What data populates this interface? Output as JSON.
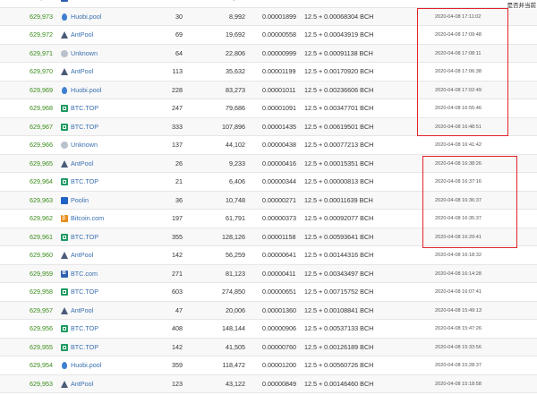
{
  "corner_text": "是否并当前",
  "rows": [
    {
      "height": "629,974",
      "pool": "BTC.com",
      "icon": "btccom",
      "tx": "9",
      "size": "4,090",
      "fee": "0.00001",
      "reward": "12.5 + 0.00...",
      "time": "2020-04-08 17:11:23"
    },
    {
      "height": "629,973",
      "pool": "Huobi.pool",
      "icon": "huobi",
      "tx": "30",
      "size": "8,992",
      "fee": "0.00001899",
      "reward": "12.5 + 0.00068304 BCH",
      "time": "2020-04-08 17:11:02"
    },
    {
      "height": "629,972",
      "pool": "AntPool",
      "icon": "antpool",
      "tx": "69",
      "size": "19,692",
      "fee": "0.00000558",
      "reward": "12.5 + 0.00043919 BCH",
      "time": "2020-04-08 17:09:48"
    },
    {
      "height": "629,971",
      "pool": "Unknown",
      "icon": "unknown",
      "tx": "64",
      "size": "22,806",
      "fee": "0.00000999",
      "reward": "12.5 + 0.00091138 BCH",
      "time": "2020-04-08 17:08:11"
    },
    {
      "height": "629,970",
      "pool": "AntPool",
      "icon": "antpool",
      "tx": "113",
      "size": "35,632",
      "fee": "0.00001199",
      "reward": "12.5 + 0.00170920 BCH",
      "time": "2020-04-08 17:06:38"
    },
    {
      "height": "629,969",
      "pool": "Huobi.pool",
      "icon": "huobi",
      "tx": "228",
      "size": "83,273",
      "fee": "0.00001011",
      "reward": "12.5 + 0.00236606 BCH",
      "time": "2020-04-08 17:02:49"
    },
    {
      "height": "629,968",
      "pool": "BTC.TOP",
      "icon": "btctop",
      "tx": "247",
      "size": "79,686",
      "fee": "0.00001091",
      "reward": "12.5 + 0.00347701 BCH",
      "time": "2020-04-08 16:55:46"
    },
    {
      "height": "629,967",
      "pool": "BTC.TOP",
      "icon": "btctop",
      "tx": "333",
      "size": "107,896",
      "fee": "0.00001435",
      "reward": "12.5 + 0.00619501 BCH",
      "time": "2020-04-08 16:48:51"
    },
    {
      "height": "629,966",
      "pool": "Unknown",
      "icon": "unknown",
      "tx": "137",
      "size": "44,102",
      "fee": "0.00000438",
      "reward": "12.5 + 0.00077213 BCH",
      "time": "2020-04-08 16:41:42"
    },
    {
      "height": "629,965",
      "pool": "AntPool",
      "icon": "antpool",
      "tx": "26",
      "size": "9,233",
      "fee": "0.00000416",
      "reward": "12.5 + 0.00015351 BCH",
      "time": "2020-04-08 16:38:26"
    },
    {
      "height": "629,964",
      "pool": "BTC.TOP",
      "icon": "btctop",
      "tx": "21",
      "size": "6,406",
      "fee": "0.00000344",
      "reward": "12.5 + 0.00000813 BCH",
      "time": "2020-04-08 16:37:16"
    },
    {
      "height": "629,963",
      "pool": "Poolin",
      "icon": "poolin",
      "tx": "36",
      "size": "10,748",
      "fee": "0.00000271",
      "reward": "12.5 + 0.00011639 BCH",
      "time": "2020-04-08 16:36:37"
    },
    {
      "height": "629,962",
      "pool": "Bitcoin.com",
      "icon": "bitcoincom",
      "tx": "197",
      "size": "61,791",
      "fee": "0.00000373",
      "reward": "12.5 + 0.00092077 BCH",
      "time": "2020-04-08 16:35:37"
    },
    {
      "height": "629,961",
      "pool": "BTC.TOP",
      "icon": "btctop",
      "tx": "355",
      "size": "128,126",
      "fee": "0.00001158",
      "reward": "12.5 + 0.00593641 BCH",
      "time": "2020-04-08 16:29:41"
    },
    {
      "height": "629,960",
      "pool": "AntPool",
      "icon": "antpool",
      "tx": "142",
      "size": "56,259",
      "fee": "0.00000641",
      "reward": "12.5 + 0.00144316 BCH",
      "time": "2020-04-08 16:18:32"
    },
    {
      "height": "629,959",
      "pool": "BTC.com",
      "icon": "btccom",
      "tx": "271",
      "size": "81,123",
      "fee": "0.00000411",
      "reward": "12.5 + 0.00343497 BCH",
      "time": "2020-04-08 16:14:28"
    },
    {
      "height": "629,958",
      "pool": "BTC.TOP",
      "icon": "btctop",
      "tx": "603",
      "size": "274,850",
      "fee": "0.00000651",
      "reward": "12.5 + 0.00715752 BCH",
      "time": "2020-04-08 16:07:41"
    },
    {
      "height": "629,957",
      "pool": "AntPool",
      "icon": "antpool",
      "tx": "47",
      "size": "20,006",
      "fee": "0.00001360",
      "reward": "12.5 + 0.00108841 BCH",
      "time": "2020-04-08 15:49:13"
    },
    {
      "height": "629,956",
      "pool": "BTC.TOP",
      "icon": "btctop",
      "tx": "408",
      "size": "148,144",
      "fee": "0.00000906",
      "reward": "12.5 + 0.00537133 BCH",
      "time": "2020-04-08 15:47:26"
    },
    {
      "height": "629,955",
      "pool": "BTC.TOP",
      "icon": "btctop",
      "tx": "142",
      "size": "41,505",
      "fee": "0.00000760",
      "reward": "12.5 + 0.00126189 BCH",
      "time": "2020-04-08 15:33:56"
    },
    {
      "height": "629,954",
      "pool": "Huobi.pool",
      "icon": "huobi",
      "tx": "359",
      "size": "118,472",
      "fee": "0.00001200",
      "reward": "12.5 + 0.00560726 BCH",
      "time": "2020-04-08 15:28:37"
    },
    {
      "height": "629,953",
      "pool": "AntPool",
      "icon": "antpool",
      "tx": "123",
      "size": "43,122",
      "fee": "0.00000849",
      "reward": "12.5 + 0.00146460 BCH",
      "time": "2020-04-08 15:18:58"
    }
  ],
  "annotations": {
    "highlight_color": "#e0242a"
  }
}
